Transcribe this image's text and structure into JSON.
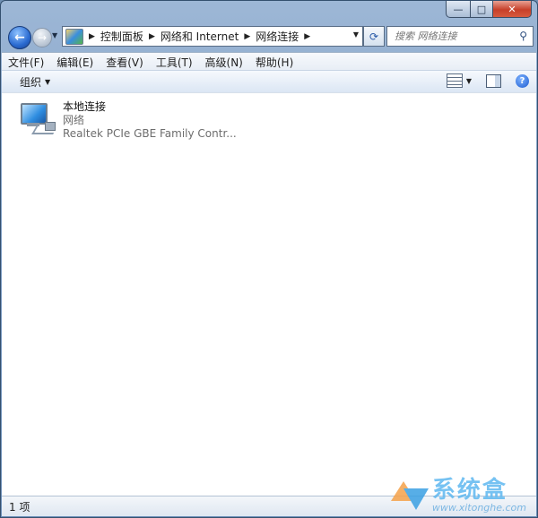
{
  "window": {
    "minimize_glyph": "—",
    "maximize_glyph": "□",
    "close_glyph": "✕"
  },
  "navigation": {
    "back_glyph": "←",
    "forward_glyph": "→",
    "breadcrumbs": [
      "控制面板",
      "网络和 Internet",
      "网络连接"
    ],
    "search_placeholder": "搜索 网络连接"
  },
  "menu": {
    "items": [
      "文件(F)",
      "编辑(E)",
      "查看(V)",
      "工具(T)",
      "高级(N)",
      "帮助(H)"
    ]
  },
  "toolbar": {
    "organize_label": "组织",
    "help_glyph": "?"
  },
  "connections": [
    {
      "name": "本地连接",
      "type": "网络",
      "device": "Realtek PCIe GBE Family Contr..."
    }
  ],
  "status": {
    "item_count": "1 项"
  },
  "watermark": {
    "title": "系统盒",
    "url": "www.xitonghe.com"
  },
  "colors": {
    "accent": "#2a6bd1",
    "close_button": "#c7402a"
  }
}
